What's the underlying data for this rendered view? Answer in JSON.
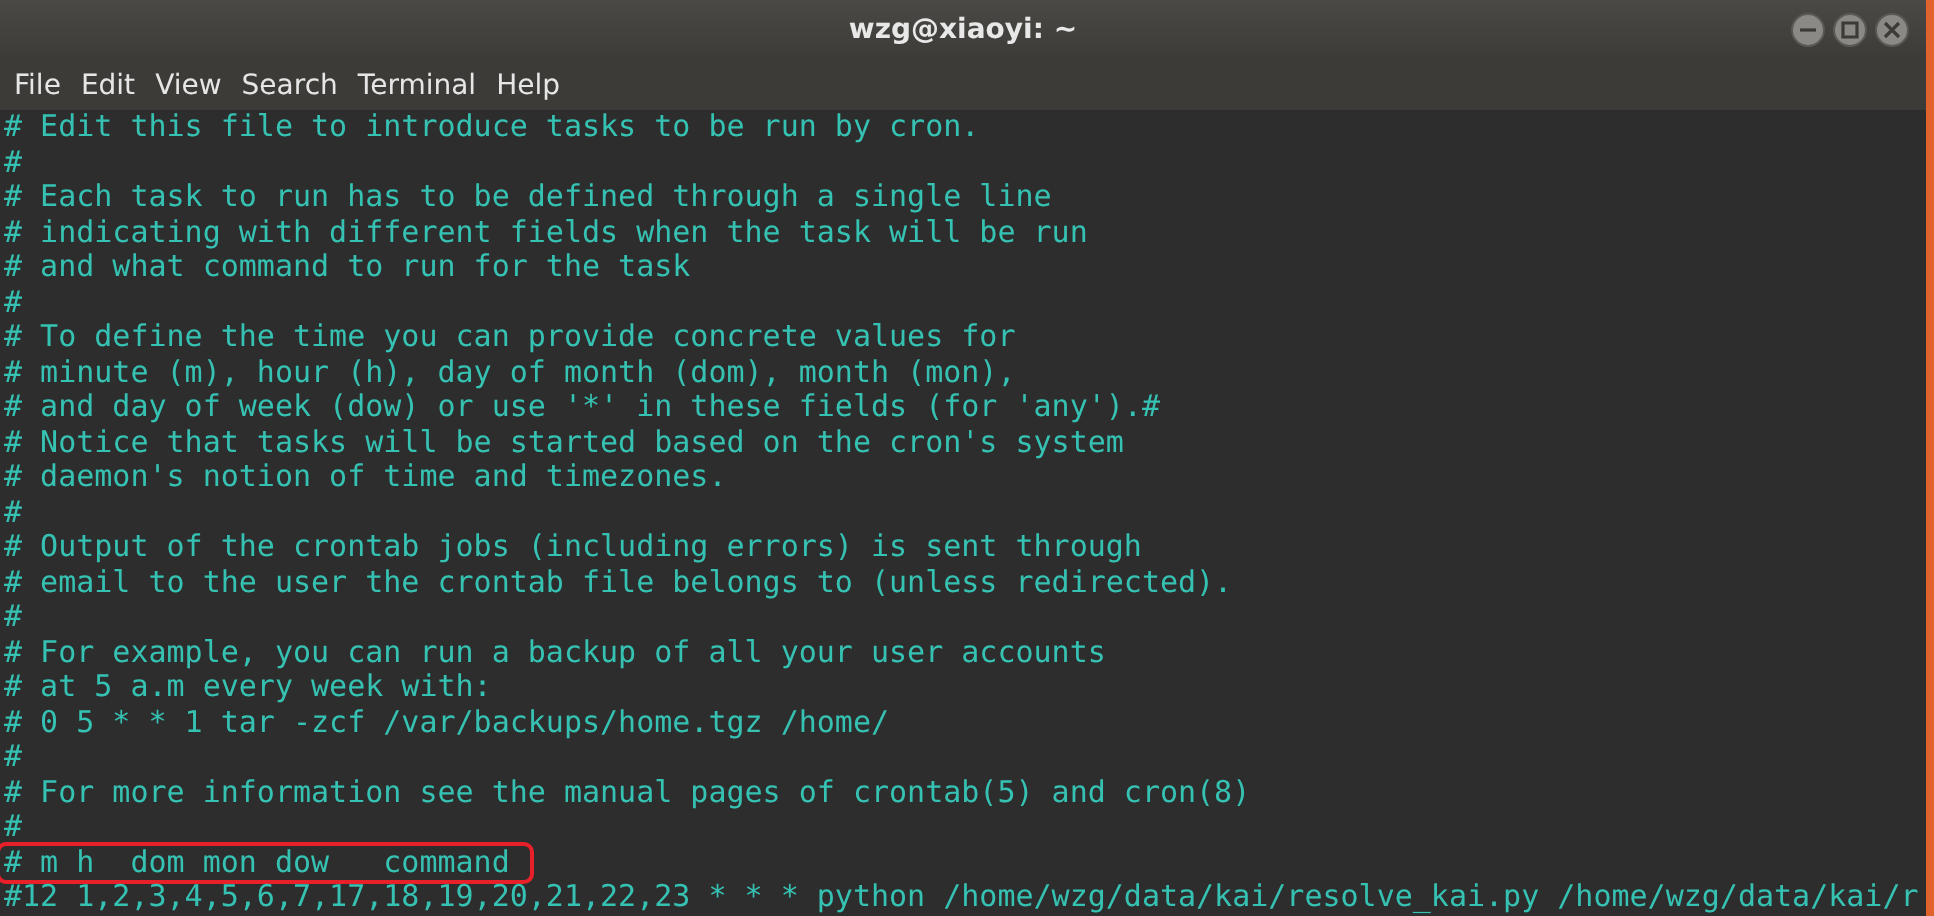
{
  "window": {
    "title": "wzg@xiaoyi: ~"
  },
  "menu": [
    "File",
    "Edit",
    "View",
    "Search",
    "Terminal",
    "Help"
  ],
  "terminal": {
    "lines": [
      {
        "text": "# Edit this file to introduce tasks to be run by cron.",
        "highlighted": false
      },
      {
        "text": "#",
        "highlighted": false
      },
      {
        "text": "# Each task to run has to be defined through a single line",
        "highlighted": false
      },
      {
        "text": "# indicating with different fields when the task will be run",
        "highlighted": false
      },
      {
        "text": "# and what command to run for the task",
        "highlighted": false
      },
      {
        "text": "#",
        "highlighted": false
      },
      {
        "text": "# To define the time you can provide concrete values for",
        "highlighted": false
      },
      {
        "text": "# minute (m), hour (h), day of month (dom), month (mon),",
        "highlighted": false
      },
      {
        "text": "# and day of week (dow) or use '*' in these fields (for 'any').#",
        "highlighted": false
      },
      {
        "text": "# Notice that tasks will be started based on the cron's system",
        "highlighted": false
      },
      {
        "text": "# daemon's notion of time and timezones.",
        "highlighted": false
      },
      {
        "text": "#",
        "highlighted": false
      },
      {
        "text": "# Output of the crontab jobs (including errors) is sent through",
        "highlighted": false
      },
      {
        "text": "# email to the user the crontab file belongs to (unless redirected).",
        "highlighted": false
      },
      {
        "text": "#",
        "highlighted": false
      },
      {
        "text": "# For example, you can run a backup of all your user accounts",
        "highlighted": false
      },
      {
        "text": "# at 5 a.m every week with:",
        "highlighted": false
      },
      {
        "text": "# 0 5 * * 1 tar -zcf /var/backups/home.tgz /home/",
        "highlighted": false
      },
      {
        "text": "#",
        "highlighted": false
      },
      {
        "text": "# For more information see the manual pages of crontab(5) and cron(8)",
        "highlighted": false
      },
      {
        "text": "#",
        "highlighted": false
      },
      {
        "text": "# m h  dom mon dow   command",
        "highlighted": true
      },
      {
        "text": "#12 1,2,3,4,5,6,7,17,18,19,20,21,22,23 * * * python /home/wzg/data/kai/resolve_kai.py /home/wzg/data/kai/r",
        "highlighted": false
      }
    ]
  }
}
